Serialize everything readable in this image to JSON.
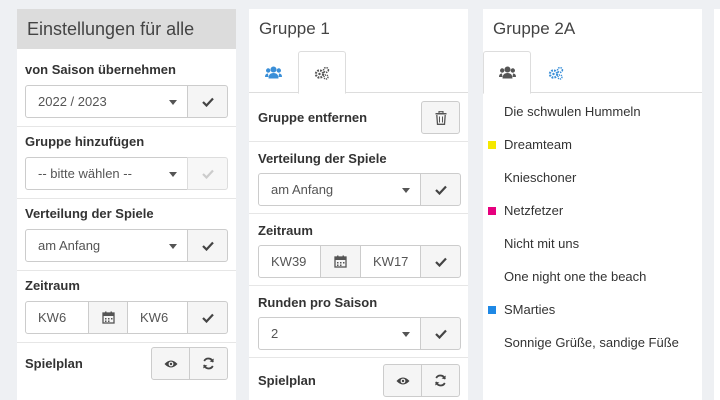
{
  "panel1": {
    "title": "Einstellungen für alle",
    "saison_label": "von Saison übernehmen",
    "saison_value": "2022 / 2023",
    "gruppe_label": "Gruppe hinzufügen",
    "gruppe_placeholder": "-- bitte wählen --",
    "verteilung_label": "Verteilung der Spiele",
    "verteilung_value": "am Anfang",
    "zeitraum_label": "Zeitraum",
    "zeitraum_from": "KW6",
    "zeitraum_to": "KW6",
    "spielplan_label": "Spielplan"
  },
  "panel2": {
    "title": "Gruppe 1",
    "entfernen_label": "Gruppe entfernen",
    "verteilung_label": "Verteilung der Spiele",
    "verteilung_value": "am Anfang",
    "zeitraum_label": "Zeitraum",
    "zeitraum_from": "KW39",
    "zeitraum_to": "KW17",
    "runden_label": "Runden pro Saison",
    "runden_value": "2",
    "spielplan_label": "Spielplan"
  },
  "panel3": {
    "title": "Gruppe 2A",
    "teams": [
      {
        "name": "Die schwulen Hummeln",
        "color": ""
      },
      {
        "name": "Dreamteam",
        "color": "#f5e800"
      },
      {
        "name": "Knieschoner",
        "color": ""
      },
      {
        "name": "Netzfetzer",
        "color": "#e6007e"
      },
      {
        "name": "Nicht mit uns",
        "color": ""
      },
      {
        "name": "One night one the beach",
        "color": ""
      },
      {
        "name": "SMarties",
        "color": "#1e88e5"
      },
      {
        "name": "Sonnige Grüße, sandige Füße",
        "color": ""
      }
    ]
  },
  "icons": {
    "users": "users-icon",
    "cogs": "cogs-icon",
    "check": "check-icon",
    "calendar": "calendar-icon",
    "trash": "trash-icon",
    "eye": "eye-icon",
    "refresh": "refresh-icon"
  },
  "colors": {
    "accent": "#3a8fd8",
    "header_bg": "#dcdcdc"
  }
}
